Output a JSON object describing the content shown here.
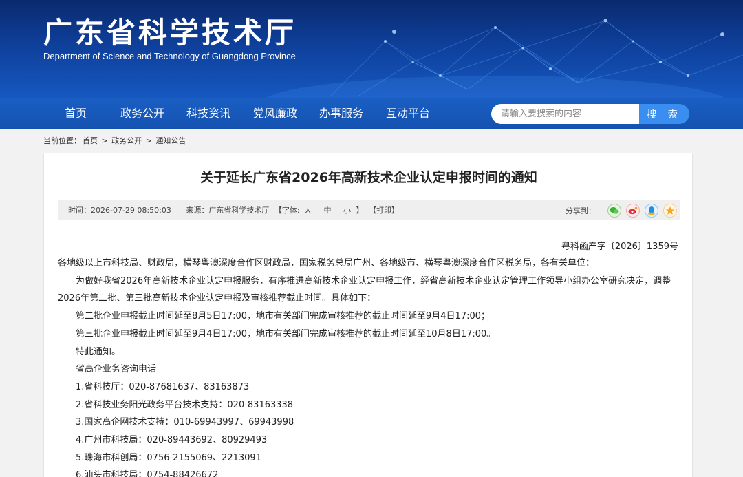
{
  "header": {
    "title": "广东省科学技术厅",
    "subtitle": "Department of Science and Technology of Guangdong Province"
  },
  "nav": {
    "items": [
      "首页",
      "政务公开",
      "科技资讯",
      "党风廉政",
      "办事服务",
      "互动平台"
    ],
    "search_placeholder": "请输入要搜索的内容",
    "search_button": "搜 索"
  },
  "breadcrumb": {
    "prefix": "当前位置：",
    "items": [
      "首页",
      "政务公开",
      "通知公告"
    ],
    "separator": ">"
  },
  "article": {
    "title": "关于延长广东省2026年高新技术企业认定申报时间的通知",
    "meta": {
      "time": "时间：2026-07-29 08:50:03",
      "source": "来源：广东省科学技术厅",
      "font_label": "【字体:",
      "font_large": "大",
      "font_medium": "中",
      "font_small": "小",
      "font_close": "】",
      "print": "【打印】",
      "share_label": "分享到："
    },
    "share_icons": [
      "wechat-icon",
      "weibo-icon",
      "qq-icon",
      "qzone-icon"
    ],
    "doc_number": "粤科函产字〔2026〕1359号",
    "paragraphs": [
      "各地级以上市科技局、财政局，横琴粤澳深度合作区财政局，国家税务总局广州、各地级市、横琴粤澳深度合作区税务局，各有关单位：",
      "为做好我省2026年高新技术企业认定申报服务，有序推进高新技术企业认定申报工作，经省高新技术企业认定管理工作领导小组办公室研究决定，调整2026年第二批、第三批高新技术企业认定申报及审核推荐截止时间。具体如下：",
      "第二批企业申报截止时间延至8月5日17:00，地市有关部门完成审核推荐的截止时间延至9月4日17:00；",
      "第三批企业申报截止时间延至9月4日17:00，地市有关部门完成审核推荐的截止时间延至10月8日17:00。",
      "特此通知。",
      "省高企业务咨询电话",
      "1.省科技厅：020-87681637、83163873",
      "2.省科技业务阳光政务平台技术支持：020-83163338",
      "3.国家高企网技术支持：010-69943997、69943998",
      "4.广州市科技局：020-89443692、80929493",
      "5.珠海市科创局：0756-2155069、2213091",
      "6.汕头市科技局：0754-88426672"
    ]
  },
  "colors": {
    "banner_dark": "#0a2a6e",
    "nav_blue": "#1a5fc4",
    "search_button": "#3a8ef0"
  }
}
